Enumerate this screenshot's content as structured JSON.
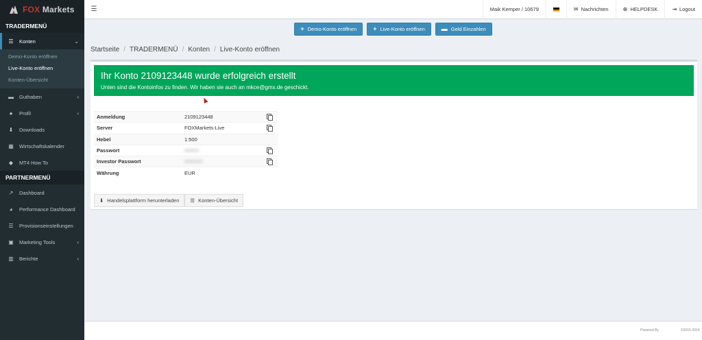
{
  "logo": {
    "brand_red": "FOX",
    "brand_rest": " Markets"
  },
  "sidebar": {
    "trader_header": "TRADERMENÜ",
    "konten_label": "Konten",
    "submenu": [
      "Demo-Konto eröffnen",
      "Live-Konto eröffnen",
      "Konten-Übersicht"
    ],
    "items": [
      "Guthaben",
      "Profil",
      "Downloads",
      "Wirtschaftskalender",
      "MT4 How To"
    ],
    "partner_header": "PARTNERMENÜ",
    "partner_items": [
      "Dashboard",
      "Performance Dashboard",
      "Provisionseinstellungen",
      "Marketing Tools",
      "Berichte"
    ]
  },
  "navbar": {
    "user": "Maik Kemper / 10679",
    "messages": "Nachrichten",
    "helpdesk": "HELPDESK",
    "logout": "Logout"
  },
  "actions": {
    "demo": "Demo-Konto eröffnen",
    "live": "Live-Konto eröffnen",
    "deposit": "Geld Einzahlen"
  },
  "breadcrumb": [
    "Startseite",
    "TRADERMENÜ",
    "Konten",
    "Live-Konto eröffnen"
  ],
  "alert": {
    "title": "Ihr Konto 2109123448 wurde erfolgreich erstellt",
    "text": "Unten sind die Kontoinfos zu finden. Wir haben sie auch an mkce@gmx.de geschickt."
  },
  "account": {
    "login_label": "Anmeldung",
    "login_value": "2109123448",
    "server_label": "Server",
    "server_value": "FOXMarkets-Live",
    "leverage_label": "Hebel",
    "leverage_value": "1:500",
    "password_label": "Passwort",
    "password_value": "••••••••",
    "investor_label": "Investor Passwort",
    "investor_value": "••••••••••",
    "currency_label": "Währung",
    "currency_value": "EUR"
  },
  "buttons": {
    "download": "Handelsplattform herunterladen",
    "overview": "Konten-Übersicht"
  },
  "footer": {
    "powered": "Powered By",
    "copyright": "©2015-2024"
  },
  "colors": {
    "sidebar": "#222d32",
    "primary": "#3c8dbc",
    "success": "#00a65a",
    "brand_red": "#c0392b"
  }
}
